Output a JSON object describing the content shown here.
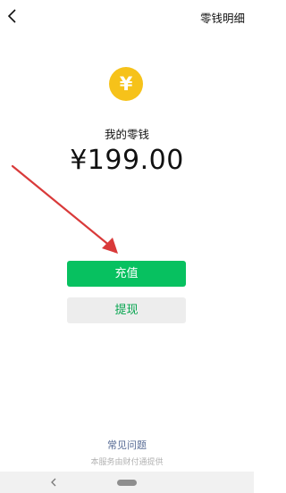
{
  "header": {
    "back_icon": "chevron-left-icon",
    "action_label": "零钱明细"
  },
  "wallet": {
    "coin_symbol": "¥",
    "label": "我的零钱",
    "balance": "¥199.00"
  },
  "buttons": {
    "recharge_label": "充值",
    "withdraw_label": "提现"
  },
  "footer": {
    "faq_label": "常见问题",
    "provider_text": "本服务由财付通提供"
  },
  "colors": {
    "primary_green": "#07c160",
    "coin_yellow": "#f6c21a",
    "link_blue": "#576b95",
    "annotation_red": "#d93a3a"
  },
  "annotation": {
    "arrow_icon": "red-arrow-annotation"
  }
}
